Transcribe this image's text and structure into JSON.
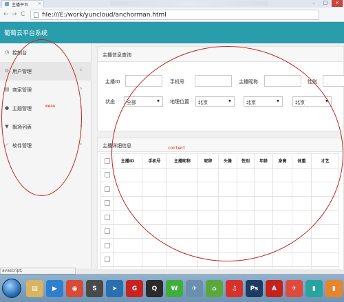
{
  "browser": {
    "tab_title": "主播平台",
    "url": "file:///E:/work/yuncloud/anchorman.html",
    "nav_back": "←",
    "nav_forward": "→",
    "reload": "C",
    "minimize": "–",
    "maximize": "□",
    "close": "×"
  },
  "app": {
    "title": "葡萄云平台系统"
  },
  "sidebar": {
    "items": [
      {
        "label": "控制台",
        "icon": "dashboard-icon",
        "glyph": "◷",
        "chevron": ""
      },
      {
        "label": "用户管理",
        "icon": "user-icon",
        "glyph": "⊙",
        "chevron": "›"
      },
      {
        "label": "商家管理",
        "icon": "store-icon",
        "glyph": "▤",
        "chevron": "›"
      },
      {
        "label": "主题管理",
        "icon": "theme-icon",
        "glyph": "●",
        "chevron": "›"
      },
      {
        "label": "飘场列表",
        "icon": "filter-icon",
        "glyph": "▼",
        "chevron": "›"
      },
      {
        "label": "软件管理",
        "icon": "wrench-icon",
        "glyph": "⟋",
        "chevron": "›"
      }
    ]
  },
  "query_panel": {
    "title": "主播信息查询",
    "fields": {
      "anchor_id_label": "主播ID",
      "phone_label": "手机号",
      "nickname_label": "主播昵称",
      "gender_label": "性别",
      "status_label": "状态",
      "status_value": "全部",
      "location_label": "地理位置",
      "location_values": [
        "北京",
        "北京",
        "北京"
      ]
    }
  },
  "detail_panel": {
    "title": "主播详细信息",
    "columns": [
      "主播ID",
      "手机号",
      "主播昵称",
      "昵称",
      "头像",
      "性别",
      "年龄",
      "身高",
      "体重",
      "才艺"
    ],
    "row_count": 8
  },
  "annotations": {
    "menu": "menu",
    "content": "content"
  },
  "status_text": "avascript;",
  "taskbar": {
    "apps": [
      {
        "name": "explorer-icon",
        "glyph": "▤",
        "color": "#d8b460"
      },
      {
        "name": "media-player-icon",
        "glyph": "▶",
        "color": "#2f7fcf"
      },
      {
        "name": "chrome-icon",
        "glyph": "◉",
        "color": "#d94a38"
      },
      {
        "name": "sublime-icon",
        "glyph": "S",
        "color": "#4a4a4a"
      },
      {
        "name": "send-icon",
        "glyph": "➤",
        "color": "#2a6fb0"
      },
      {
        "name": "app-red-icon",
        "glyph": "G",
        "color": "#c8231e"
      },
      {
        "name": "qq-icon",
        "glyph": "Q",
        "color": "#2a2a2a"
      },
      {
        "name": "wechat-icon",
        "glyph": "W",
        "color": "#3fae3a"
      },
      {
        "name": "network-icon",
        "glyph": "✈",
        "color": "#6b8fae"
      },
      {
        "name": "home-icon",
        "glyph": "⌂",
        "color": "#5aa83d"
      },
      {
        "name": "netease-music-icon",
        "glyph": "♫",
        "color": "#d8312a"
      },
      {
        "name": "photoshop-icon",
        "glyph": "Ps",
        "color": "#1d3b63"
      },
      {
        "name": "pdf-icon",
        "glyph": "A",
        "color": "#c5221b"
      },
      {
        "name": "red-app-icon",
        "glyph": "✈",
        "color": "#e04a3a"
      },
      {
        "name": "flat-app-icon",
        "glyph": "▮",
        "color": "#27a3a1"
      },
      {
        "name": "flat-app-2-icon",
        "glyph": "▮",
        "color": "#e8842c"
      }
    ]
  }
}
